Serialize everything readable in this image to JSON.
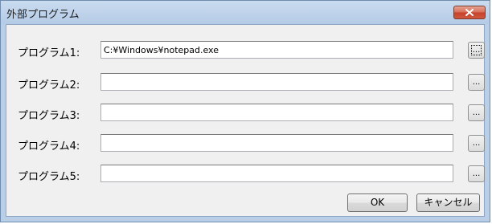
{
  "window": {
    "title": "外部プログラム"
  },
  "rows": [
    {
      "label": "プログラム1:",
      "value": "C:¥Windows¥notepad.exe",
      "browse_label": "..."
    },
    {
      "label": "プログラム2:",
      "value": "",
      "browse_label": "..."
    },
    {
      "label": "プログラム3:",
      "value": "",
      "browse_label": "..."
    },
    {
      "label": "プログラム4:",
      "value": "",
      "browse_label": "..."
    },
    {
      "label": "プログラム5:",
      "value": "",
      "browse_label": "..."
    }
  ],
  "buttons": {
    "ok_label": "OK",
    "cancel_label": "キャンセル"
  },
  "icons": {
    "close": "close-icon"
  },
  "colors": {
    "titlebar": "#b9cfe8",
    "close_button": "#c7412b"
  }
}
